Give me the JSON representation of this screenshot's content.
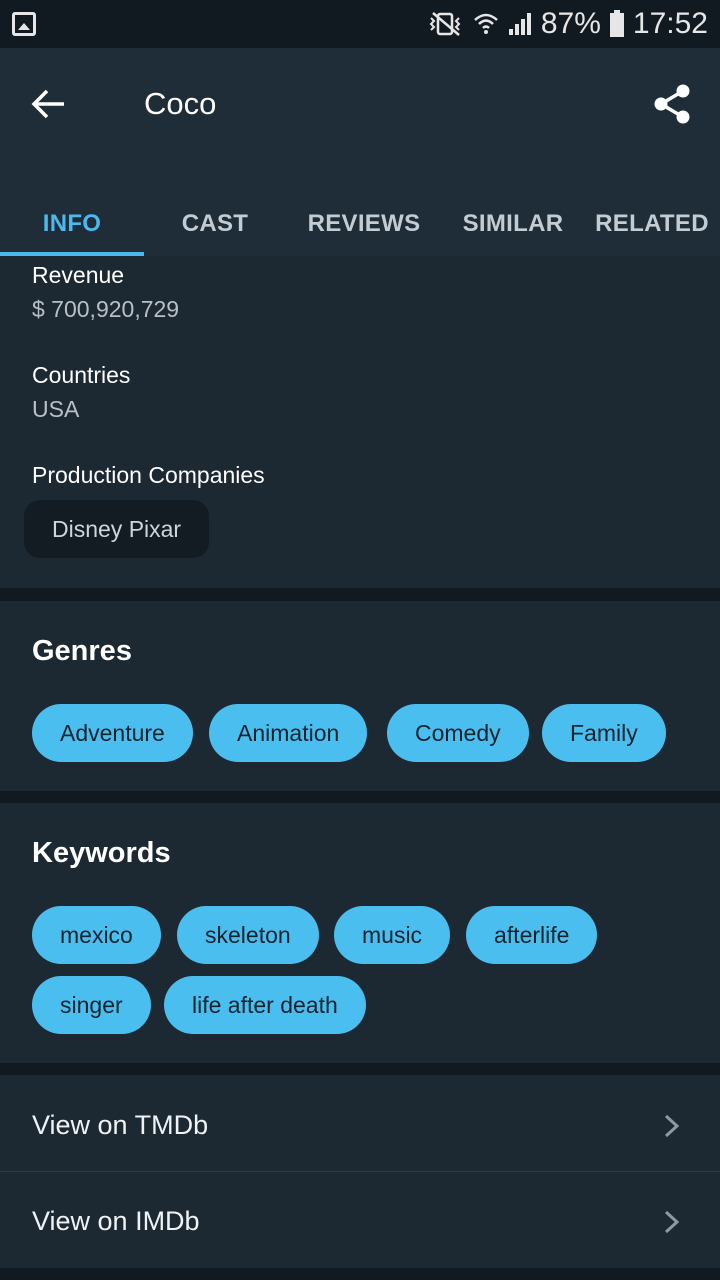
{
  "status_bar": {
    "battery": "87%",
    "time": "17:52"
  },
  "app_bar": {
    "title": "Coco"
  },
  "tabs": [
    {
      "label": "INFO",
      "active": true
    },
    {
      "label": "CAST",
      "active": false
    },
    {
      "label": "REVIEWS",
      "active": false
    },
    {
      "label": "SIMILAR",
      "active": false
    },
    {
      "label": "RELATED",
      "active": false
    }
  ],
  "info": {
    "revenue_label": "Revenue",
    "revenue_value": "$ 700,920,729",
    "countries_label": "Countries",
    "countries_value": "USA",
    "production_label": "Production Companies",
    "production_companies": [
      "Disney Pixar"
    ]
  },
  "genres": {
    "title": "Genres",
    "items": [
      "Adventure",
      "Animation",
      "Comedy",
      "Family"
    ]
  },
  "keywords": {
    "title": "Keywords",
    "items": [
      "mexico",
      "skeleton",
      "music",
      "afterlife",
      "singer",
      "life after death"
    ]
  },
  "links": {
    "tmdb": "View on TMDb",
    "imdb": "View on IMDb"
  },
  "colors": {
    "accent": "#4bb9ee",
    "chip": "#4bbef0",
    "background": "#121a21",
    "card": "#1c2832",
    "appbar": "#1e2d38"
  }
}
